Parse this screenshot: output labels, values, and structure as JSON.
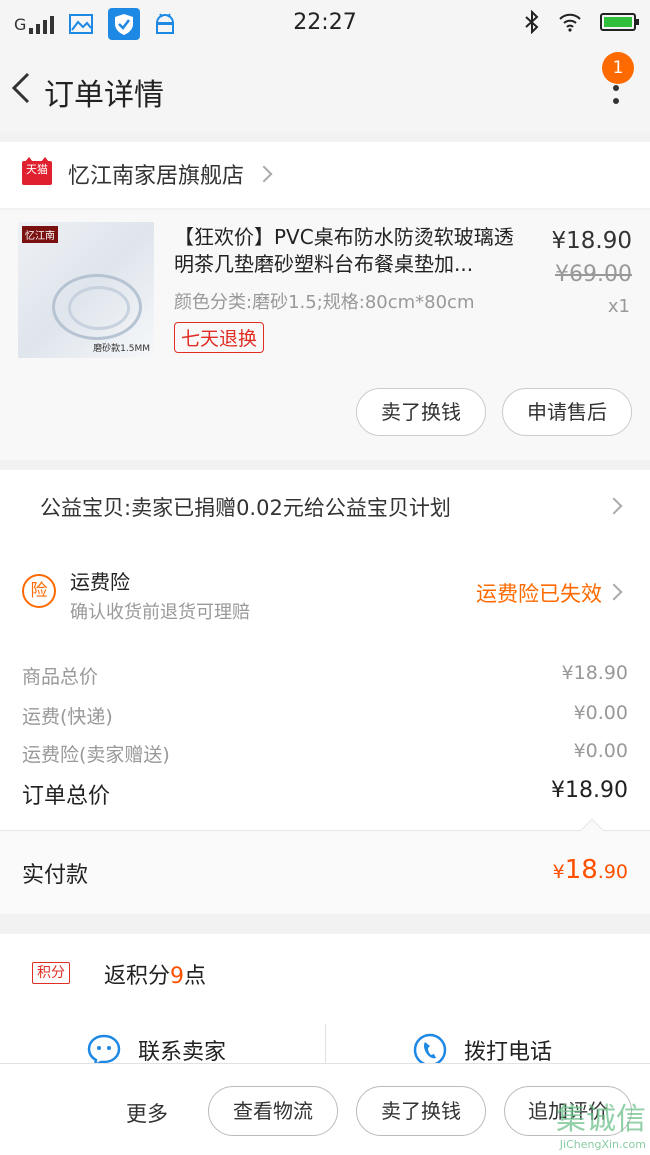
{
  "status_bar": {
    "carrier": "G",
    "time": "22:27"
  },
  "header": {
    "title": "订单详情",
    "badge_count": "1"
  },
  "shop": {
    "badge": "天猫",
    "name": "忆江南家居旗舰店"
  },
  "product": {
    "thumb_logo": "忆江南",
    "thumb_caption": "磨砂款1.5MM",
    "title": "【狂欢价】PVC桌布防水防烫软玻璃透明茶几垫磨砂塑料台布餐桌垫加...",
    "spec": "颜色分类:磨砂1.5;规格:80cm*80cm",
    "tag": "七天退换",
    "price": "¥18.90",
    "original_price": "¥69.00",
    "quantity": "x1",
    "buttons": [
      "卖了换钱",
      "申请售后"
    ]
  },
  "charity": {
    "text": "公益宝贝:卖家已捐赠0.02元给公益宝贝计划"
  },
  "insurance": {
    "icon": "险",
    "title": "运费险",
    "subtitle": "确认收货前退货可理赔",
    "status": "运费险已失效"
  },
  "breakdown": {
    "rows": [
      {
        "label": "商品总价",
        "value": "¥18.90"
      },
      {
        "label": "运费(快递)",
        "value": "¥0.00"
      },
      {
        "label": "运费险(卖家赠送)",
        "value": "¥0.00"
      }
    ],
    "total_label": "订单总价",
    "total_value": "¥18.90"
  },
  "paid": {
    "label": "实付款",
    "currency": "¥",
    "integer": "18",
    "decimal": ".90"
  },
  "points": {
    "tag": "积分",
    "prefix": "返积分",
    "number": "9",
    "suffix": "点"
  },
  "contact": {
    "seller": "联系卖家",
    "phone": "拨打电话"
  },
  "bottom_bar": {
    "more": "更多",
    "buttons": [
      "查看物流",
      "卖了换钱",
      "追加评价"
    ]
  },
  "watermark": {
    "big": "集诚信",
    "small": "JiChengXin.com"
  },
  "colors": {
    "accent": "#ff5000",
    "insurance": "#ff6a00",
    "tmall_red": "#e0202e",
    "tag_red": "#e02e24"
  }
}
